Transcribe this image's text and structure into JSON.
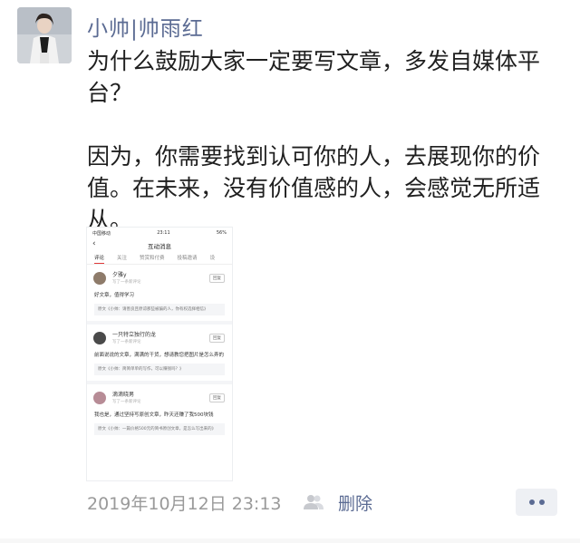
{
  "post": {
    "author": "小帅|帅雨红",
    "text": "为什么鼓励大家一定要写文章，多发自媒体平台？\n\n因为，你需要找到认可你的人，去展现你的价值。在未来，没有价值感的人，会感觉无所适从。",
    "timestamp": "2019年10月12日 23:13",
    "delete_label": "删除"
  },
  "screenshot": {
    "status_bar": {
      "signal": "中国移动",
      "time": "23:11",
      "battery": "56%"
    },
    "page_title": "互动消息",
    "tabs": [
      "评论",
      "关注",
      "赞赏和付费",
      "投稿邀请",
      "设"
    ],
    "comments": [
      {
        "name": "夕雅y",
        "sub": "写了一条新评论",
        "reply": "回复",
        "body": "好文章，值得学习",
        "quote": "原文《小帅：请善良且原谅那些被骗的人，你有权选择相信》"
      },
      {
        "name": "一只特立独行的龙",
        "sub": "写了一条新评论",
        "reply": "回复",
        "body": "前面说说的文章，满满的干货，想请教您把图片是怎么弄的",
        "quote": "原文《小帅：简简单单的写作，可以赚钱吗？》"
      },
      {
        "name": "滴滴晓男",
        "sub": "写了一条新评论",
        "reply": "回复",
        "body": "我也是，通过坚持写原创文章，昨天还赚了我500块钱",
        "quote": "原文《小帅：一篇价格500元的简书原创文章，是怎么写出来的》"
      }
    ]
  },
  "colors": {
    "link": "#5b6b93",
    "muted": "#9a9a9a"
  }
}
